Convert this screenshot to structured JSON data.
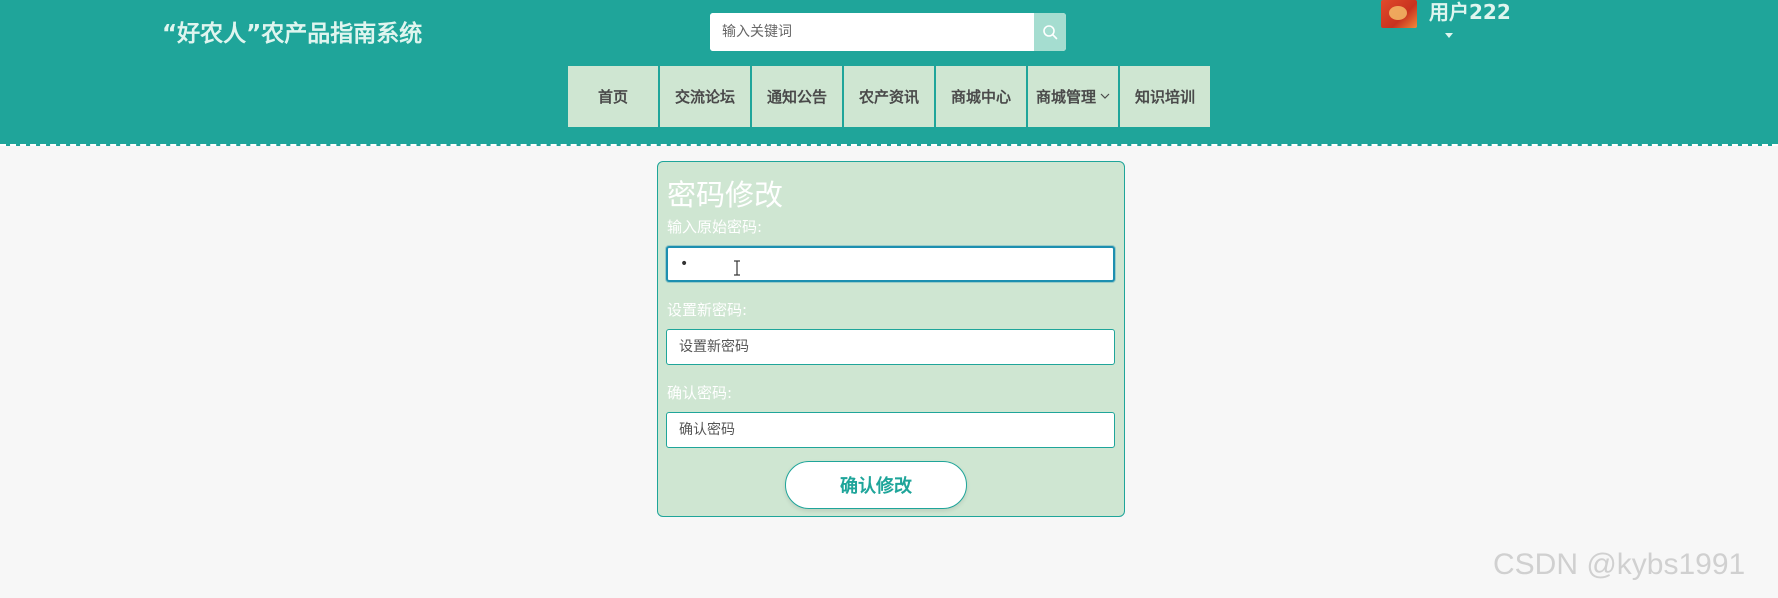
{
  "header": {
    "site_title": "“好农人”农产品指南系统",
    "search_placeholder": "输入关键词",
    "user_name": "用户222"
  },
  "nav": {
    "items": [
      {
        "label": "首页"
      },
      {
        "label": "交流论坛"
      },
      {
        "label": "通知公告"
      },
      {
        "label": "农产资讯"
      },
      {
        "label": "商城中心"
      },
      {
        "label": "商城管理"
      },
      {
        "label": "知识培训"
      }
    ]
  },
  "form": {
    "title": "密码修改",
    "old_password_label": "输入原始密码:",
    "old_password_value": "•",
    "new_password_label": "设置新密码:",
    "new_password_placeholder": "设置新密码",
    "confirm_password_label": "确认密码:",
    "confirm_password_placeholder": "确认密码",
    "submit_label": "确认修改"
  },
  "watermark": "CSDN @kybs1991",
  "colors": {
    "header_bg": "#1fa59a",
    "nav_bg": "#cfe6d2",
    "card_bg": "#cfe6d2",
    "accent": "#1fa59a",
    "page_bg": "#f7f7f7"
  }
}
